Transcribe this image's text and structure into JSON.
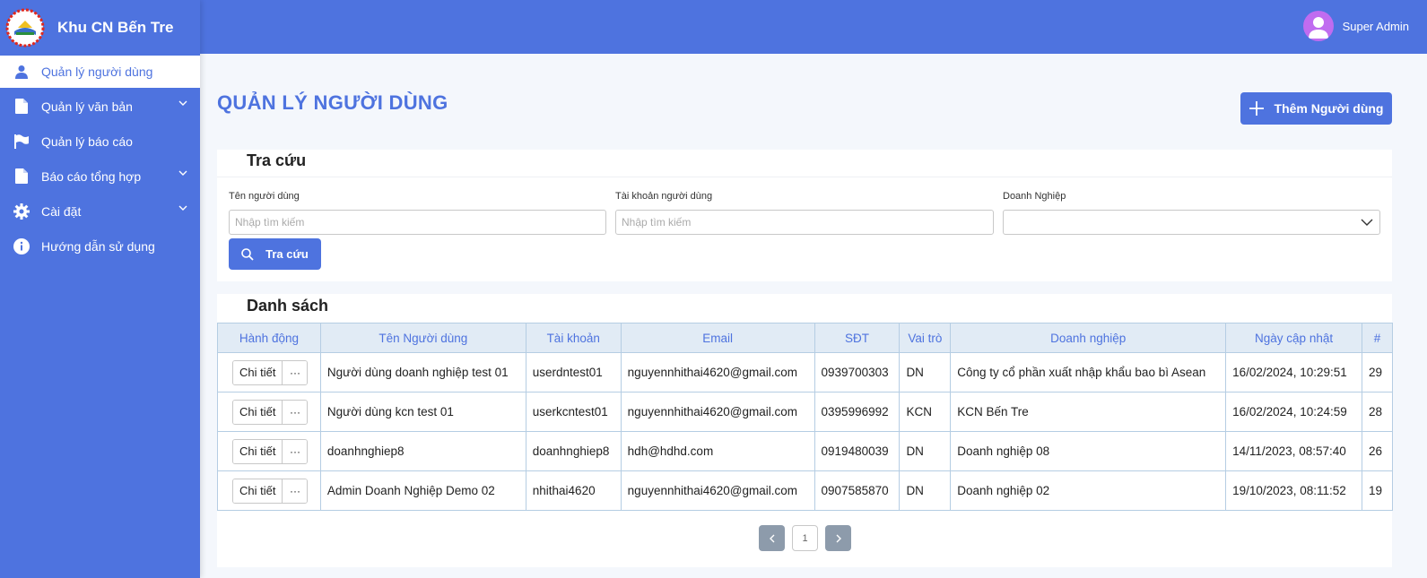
{
  "app": {
    "name": "Khu CN Bến Tre"
  },
  "user": {
    "name": "Super Admin"
  },
  "sidebar": {
    "items": [
      {
        "label": "Quản lý người dùng",
        "icon": "user-icon"
      },
      {
        "label": "Quản lý văn bản",
        "icon": "file-icon"
      },
      {
        "label": "Quản lý báo cáo",
        "icon": "flag-icon"
      },
      {
        "label": "Báo cáo tổng hợp",
        "icon": "file-icon"
      },
      {
        "label": "Cài đặt",
        "icon": "gear-icon"
      },
      {
        "label": "Hướng dẫn sử dụng",
        "icon": "info-icon"
      }
    ]
  },
  "page": {
    "title": "QUẢN LÝ NGƯỜI DÙNG",
    "add_button": "Thêm Người dùng"
  },
  "search": {
    "title": "Tra cứu",
    "name_label": "Tên người dùng",
    "name_placeholder": "Nhập tìm kiếm",
    "account_label": "Tài khoản người dùng",
    "account_placeholder": "Nhập tìm kiếm",
    "company_label": "Doanh Nghiệp",
    "button": "Tra cứu"
  },
  "list": {
    "title": "Danh sách",
    "columns": [
      "Hành động",
      "Tên Người dùng",
      "Tài khoản",
      "Email",
      "SĐT",
      "Vai trò",
      "Doanh nghiệp",
      "Ngày cập nhật",
      "#"
    ],
    "detail_label": "Chi tiết",
    "more_label": "···",
    "rows": [
      {
        "name": "Người dùng doanh nghiệp test 01",
        "account": "userdntest01",
        "email": "nguyennhithai4620@gmail.com",
        "phone": "0939700303",
        "role": "DN",
        "company": "Công ty cổ phần xuất nhập khẩu bao bì Asean",
        "updated": "16/02/2024, 10:29:51",
        "id": "29"
      },
      {
        "name": "Người dùng kcn test 01",
        "account": "userkcntest01",
        "email": "nguyennhithai4620@gmail.com",
        "phone": "0395996992",
        "role": "KCN",
        "company": "KCN Bến Tre",
        "updated": "16/02/2024, 10:24:59",
        "id": "28"
      },
      {
        "name": "doanhnghiep8",
        "account": "doanhnghiep8",
        "email": "hdh@hdhd.com",
        "phone": "0919480039",
        "role": "DN",
        "company": "Doanh nghiệp 08",
        "updated": "14/11/2023, 08:57:40",
        "id": "26"
      },
      {
        "name": "Admin Doanh Nghiệp Demo 02",
        "account": "nhithai4620",
        "email": "nguyennhithai4620@gmail.com",
        "phone": "0907585870",
        "role": "DN",
        "company": "Doanh nghiệp 02",
        "updated": "19/10/2023, 08:11:52",
        "id": "19"
      }
    ]
  },
  "pagination": {
    "current": "1"
  },
  "colors": {
    "primary": "#4e73df",
    "header_bg": "#e1ebf5",
    "pager_nav": "#8d9bab"
  }
}
